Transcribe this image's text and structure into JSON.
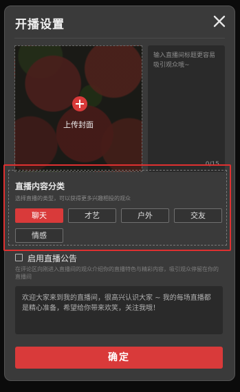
{
  "dialog": {
    "title": "开播设置",
    "close_icon": "close-icon"
  },
  "cover": {
    "upload_label": "上传封面",
    "upload_icon": "plus-circle-icon"
  },
  "title_input": {
    "placeholder": "输入直播间标题更容易吸引观众哦~",
    "count": "0/15"
  },
  "category": {
    "title": "直播内容分类",
    "subtitle": "选择直播的类型，可以获得更多兴趣相投的观众",
    "options": [
      "聊天",
      "才艺",
      "户外",
      "交友",
      "情感"
    ],
    "selected": "聊天"
  },
  "announcement": {
    "label": "启用直播公告",
    "enabled": false,
    "description": "在评论区向刚进入直播间的观众介绍你的直播特色与精彩内容，吸引观众停留在你的直播间",
    "text": "欢迎大家来到我的直播间，很高兴认识大家 ~ 我的每场直播都是精心准备，希望给你带来欢笑，关注我哦！"
  },
  "actions": {
    "confirm_label": "确定"
  },
  "colors": {
    "accent": "#d93a3a",
    "dialog_bg": "#3a3a3a",
    "highlight_border": "#e03030"
  }
}
